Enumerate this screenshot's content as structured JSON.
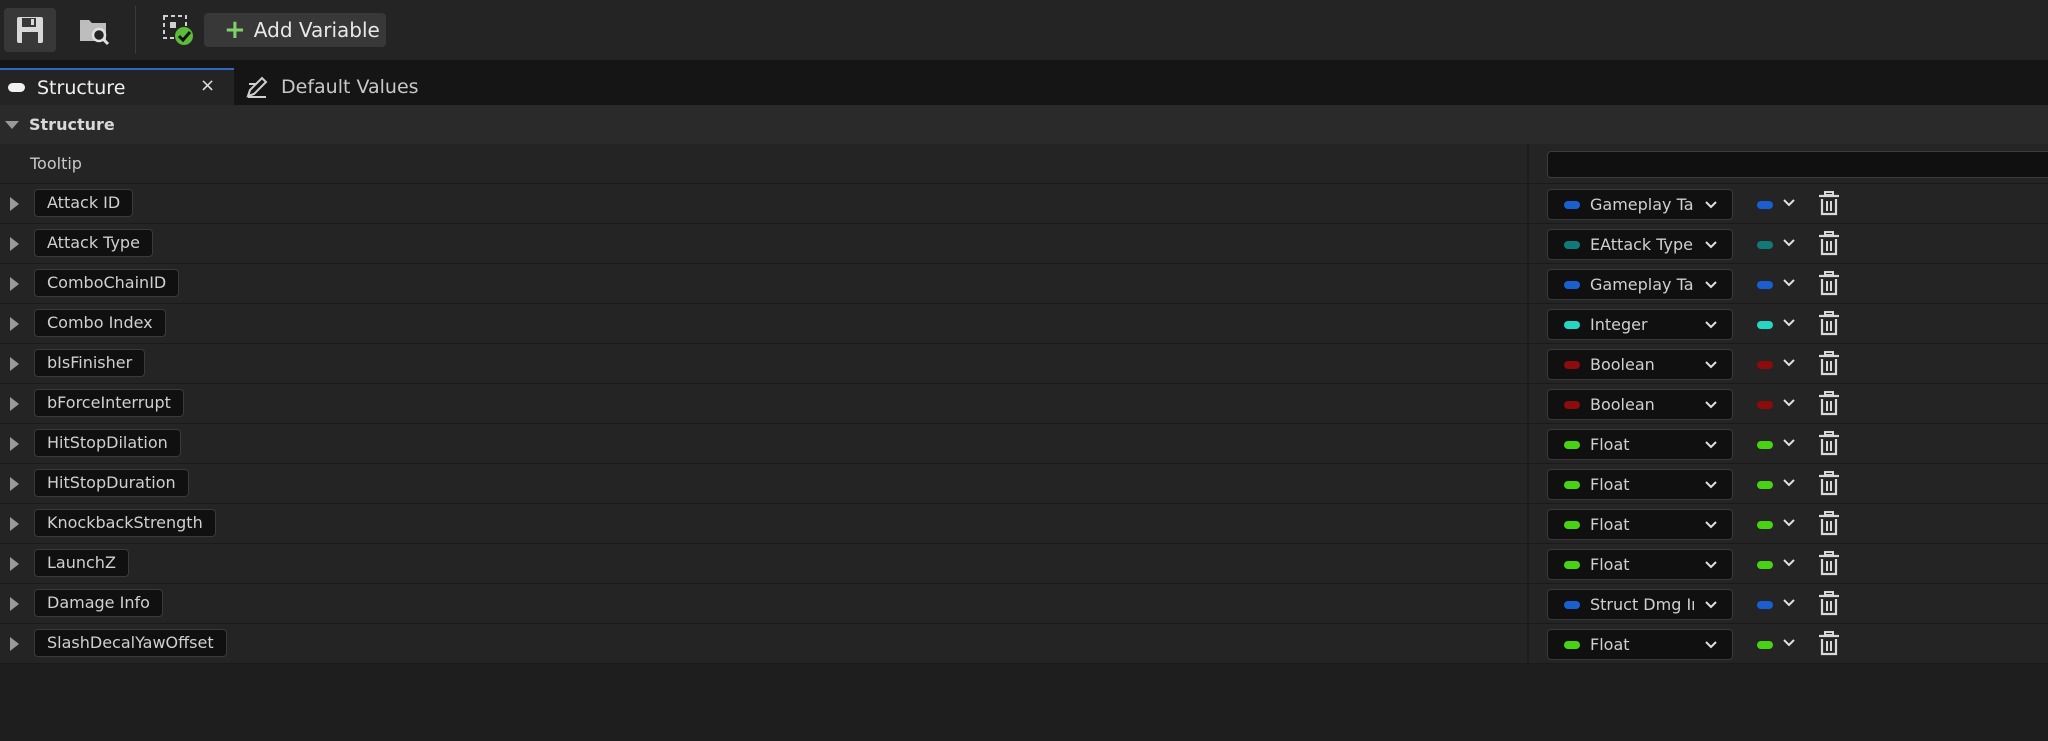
{
  "toolbar": {
    "save_icon": "save-icon",
    "browse_icon": "browse-icon",
    "struct_status_icon": "struct-status-icon",
    "add_variable_label": "Add Variable"
  },
  "tabs": {
    "structure_label": "Structure",
    "default_values_label": "Default Values",
    "close_glyph": "×"
  },
  "section": {
    "title": "Structure"
  },
  "tooltip_row": {
    "label": "Tooltip",
    "value": ""
  },
  "colors": {
    "gameplay_tag": "#1a5fd0",
    "enum": "#117a78",
    "integer": "#26d5c4",
    "boolean": "#8c0b0b",
    "float": "#49d214",
    "struct": "#1a5fd0"
  },
  "variables": [
    {
      "name": "Attack ID",
      "type": "Gameplay Tag",
      "color": "#1a5fd0"
    },
    {
      "name": "Attack Type",
      "type": "EAttack Type",
      "color": "#117a78"
    },
    {
      "name": "ComboChainID",
      "type": "Gameplay Tag",
      "color": "#1a5fd0"
    },
    {
      "name": "Combo Index",
      "type": "Integer",
      "color": "#26d5c4"
    },
    {
      "name": "bIsFinisher",
      "type": "Boolean",
      "color": "#8c0b0b"
    },
    {
      "name": "bForceInterrupt",
      "type": "Boolean",
      "color": "#8c0b0b"
    },
    {
      "name": "HitStopDilation",
      "type": "Float",
      "color": "#49d214"
    },
    {
      "name": "HitStopDuration",
      "type": "Float",
      "color": "#49d214"
    },
    {
      "name": "KnockbackStrength",
      "type": "Float",
      "color": "#49d214"
    },
    {
      "name": "LaunchZ",
      "type": "Float",
      "color": "#49d214"
    },
    {
      "name": "Damage Info",
      "type": "Struct Dmg Inf",
      "color": "#1a5fd0"
    },
    {
      "name": "SlashDecalYawOffset",
      "type": "Float",
      "color": "#49d214"
    }
  ]
}
